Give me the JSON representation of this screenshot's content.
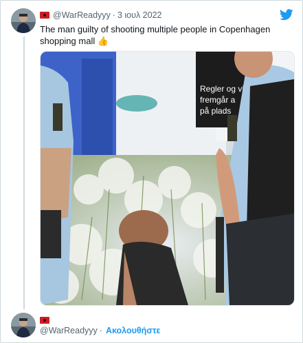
{
  "tweet": {
    "handle": "@WarReadyyy",
    "separator": "·",
    "date": "3 ιουλ 2022",
    "text": "The man guilty of shooting multiple people in Copenhagen shopping mall",
    "emoji": "👍",
    "sign_text": [
      "Regler og vil",
      "fremgår a",
      "på plads"
    ]
  },
  "footer": {
    "handle": "@WarReadyyy",
    "separator": "·",
    "follow_label": "Ακολουθήστε"
  },
  "colors": {
    "accent": "#1d9bf0",
    "secondary_text": "#536471",
    "border": "#cfd9de"
  },
  "icons": {
    "brand": "twitter-bird-icon",
    "flag": "country-flag-icon"
  }
}
